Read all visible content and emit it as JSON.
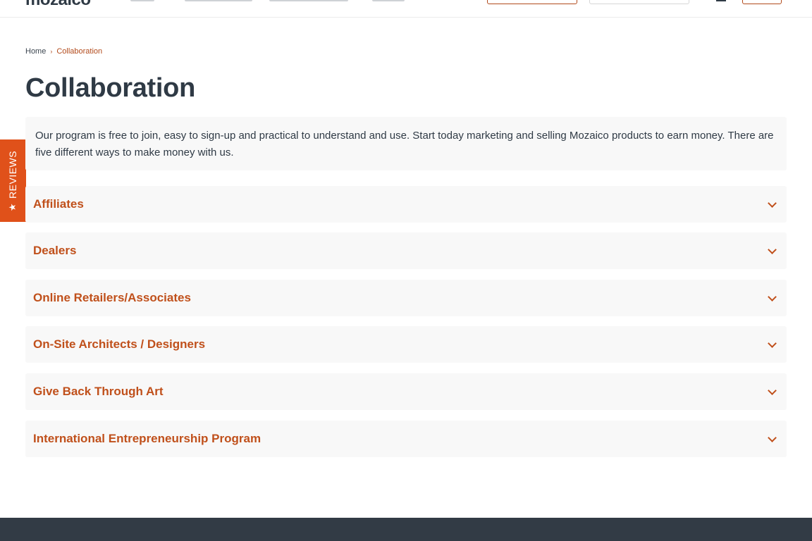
{
  "header": {
    "logo": "mozaico"
  },
  "reviews_tab": {
    "label": "REVIEWS",
    "icon": "star-icon"
  },
  "breadcrumb": {
    "home": "Home",
    "separator": "›",
    "current": "Collaboration"
  },
  "page": {
    "title": "Collaboration",
    "intro": "Our program is free to join, easy to sign-up and practical to understand and use. Start today marketing and selling Mozaico products to earn money. There are five different ways to make money with us."
  },
  "accordion": [
    {
      "label": "Affiliates"
    },
    {
      "label": "Dealers"
    },
    {
      "label": "Online Retailers/Associates"
    },
    {
      "label": "On-Site Architects / Designers"
    },
    {
      "label": "Give Back Through Art"
    },
    {
      "label": "International Entrepreneurship Program"
    }
  ],
  "colors": {
    "accent": "#c0501b",
    "reviews_tab": "#e0511a",
    "text_dark": "#2f3a45",
    "panel_bg": "#f8f8f8",
    "footer_bg": "#323b45"
  }
}
